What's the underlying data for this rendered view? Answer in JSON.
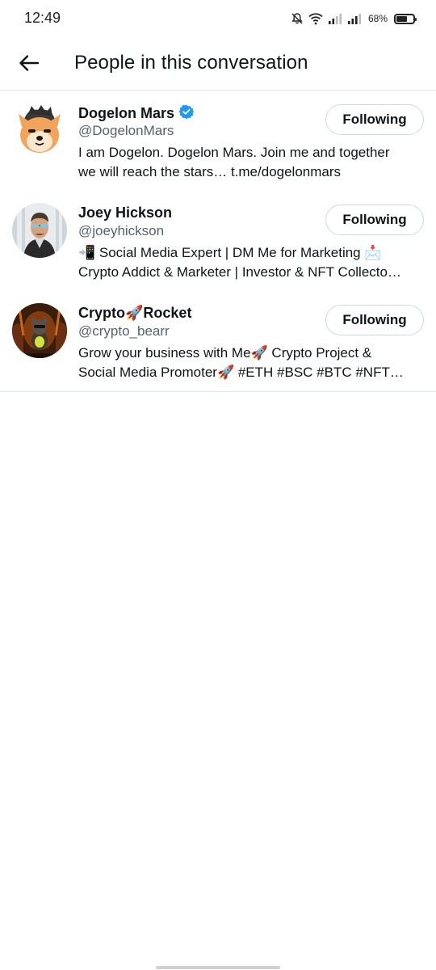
{
  "status_bar": {
    "time": "12:49",
    "battery_percent_label": "68%",
    "battery_level": 0.68,
    "icons": [
      "mute-bell-icon",
      "wifi-icon",
      "signal-icon",
      "signal-icon"
    ]
  },
  "header": {
    "back_icon": "arrow-left-icon",
    "title": "People in this conversation"
  },
  "users": [
    {
      "name": "Dogelon Mars",
      "verified": true,
      "handle": "@DogelonMars",
      "bio_lines": [
        "I am Dogelon. Dogelon Mars. Join me and together",
        "we will reach the stars…  t.me/dogelonmars"
      ],
      "follow_label": "Following"
    },
    {
      "name": "Joey Hickson",
      "verified": false,
      "handle": "@joeyhickson",
      "bio_lines": [
        "📲 Social Media Expert | DM Me for Marketing 📩",
        "Crypto Addict & Marketer | Investor & NFT Collecto…"
      ],
      "follow_label": "Following"
    },
    {
      "name": "Crypto🚀Rocket",
      "verified": false,
      "handle": "@crypto_bearr",
      "bio_lines": [
        "Grow your business with Me🚀 Crypto Project &",
        "Social Media Promoter🚀 #ETH #BSC #BTC #NFT…"
      ],
      "follow_label": "Following"
    }
  ],
  "colors": {
    "accent": "#1d9bf0",
    "text_primary": "#0f1419",
    "text_secondary": "#536471",
    "divider": "#e1e8ed"
  }
}
